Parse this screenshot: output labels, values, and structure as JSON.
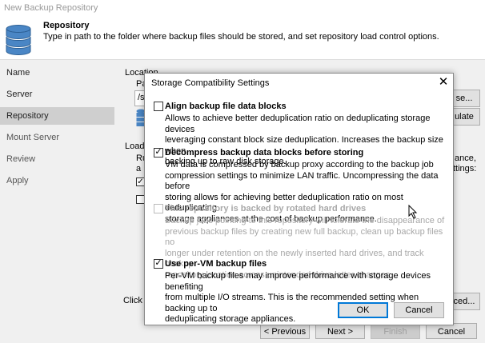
{
  "window": {
    "title": "New Backup Repository"
  },
  "header": {
    "title": "Repository",
    "description": "Type in path to the folder where backup files should be stored, and set repository load control options."
  },
  "nav": {
    "items": [
      {
        "label": "Name"
      },
      {
        "label": "Server"
      },
      {
        "label": "Repository"
      },
      {
        "label": "Mount Server"
      },
      {
        "label": "Review"
      },
      {
        "label": "Apply"
      }
    ],
    "active_index": 2
  },
  "background_fragments": {
    "location": "Location",
    "pa": "Pa",
    "path_start": "/s",
    "browse_end": "se...",
    "populate_end": "ulate",
    "load": "Load",
    "ru": "Ru",
    "a": "a",
    "ance_end": "ance,",
    "ttings_end": "ttings:",
    "click": "Click A",
    "advanced_end": "ced..."
  },
  "footer": {
    "previous": "< Previous",
    "next": "Next >",
    "finish": "Finish",
    "cancel": "Cancel"
  },
  "dialog": {
    "title": "Storage Compatibility Settings",
    "close_glyph": "✕",
    "options": [
      {
        "label": "Align backup file data blocks",
        "checked": false,
        "enabled": true,
        "desc": [
          "Allows to achieve better deduplication ratio on deduplicating storage devices",
          "leveraging constant block size deduplication. Increases the backup size when",
          "backing up to raw disk storage."
        ]
      },
      {
        "label": "Decompress backup data blocks before storing",
        "checked": true,
        "enabled": true,
        "desc": [
          "VM data is compressed by backup proxy according to the backup job",
          "compression settings to minimize LAN traffic. Uncompressing the data before",
          "storing allows for achieving better deduplication ratio on most deduplicating",
          "storage appliances at the cost of backup performance."
        ]
      },
      {
        "label": "This repository is backed by rotated hard drives",
        "checked": false,
        "enabled": false,
        "desc": [
          "Backup jobs pointing to this repository will tolerate the disappearance of",
          "previous backup files by creating new full backup, clean up backup files no",
          "longer under retention on the newly inserted hard drives, and track backup",
          "repository location across unintended drive letter changes."
        ]
      },
      {
        "label": "Use per-VM backup files",
        "checked": true,
        "enabled": true,
        "desc": [
          "Per-VM backup files may improve performance with storage devices benefiting",
          "from multiple I/O streams. This is the recommended setting when backing up to",
          "deduplicating storage appliances."
        ]
      }
    ],
    "ok": "OK",
    "cancel": "Cancel"
  },
  "colors": {
    "accent": "#0078d7",
    "nav_active": "#cfcfcf",
    "disabled_text": "#a8a8a8"
  }
}
